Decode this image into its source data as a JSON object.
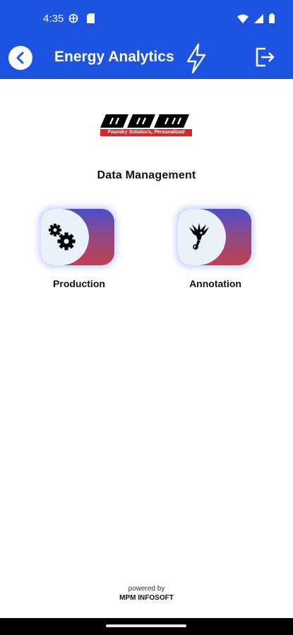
{
  "status_bar": {
    "time": "4:35",
    "left_icons": [
      "vpn-icon",
      "sim-card-icon"
    ],
    "right_icons": [
      "wifi-icon",
      "cellular-signal-icon",
      "battery-icon"
    ]
  },
  "app_bar": {
    "title": "Energy Analytics",
    "back_icon": "chevron-left-icon",
    "title_icon": "lightning-bolt-icon",
    "logout_icon": "logout-icon"
  },
  "logo": {
    "brand": "MPM",
    "tagline": "Foundry Solutions, Personalized"
  },
  "section_title": "Data Management",
  "tiles": [
    {
      "label": "Production",
      "icon": "gears-icon"
    },
    {
      "label": "Annotation",
      "icon": "dove-pen-icon"
    }
  ],
  "footer": {
    "powered_by": "powered by",
    "company": "MPM INFOSOFT"
  },
  "colors": {
    "primary": "#1c53e0",
    "tile_gradient_top": "#4a4fcf",
    "tile_gradient_bottom": "#c4404e",
    "tile_inner": "#e9f1fb",
    "logo_red": "#d8262c"
  }
}
